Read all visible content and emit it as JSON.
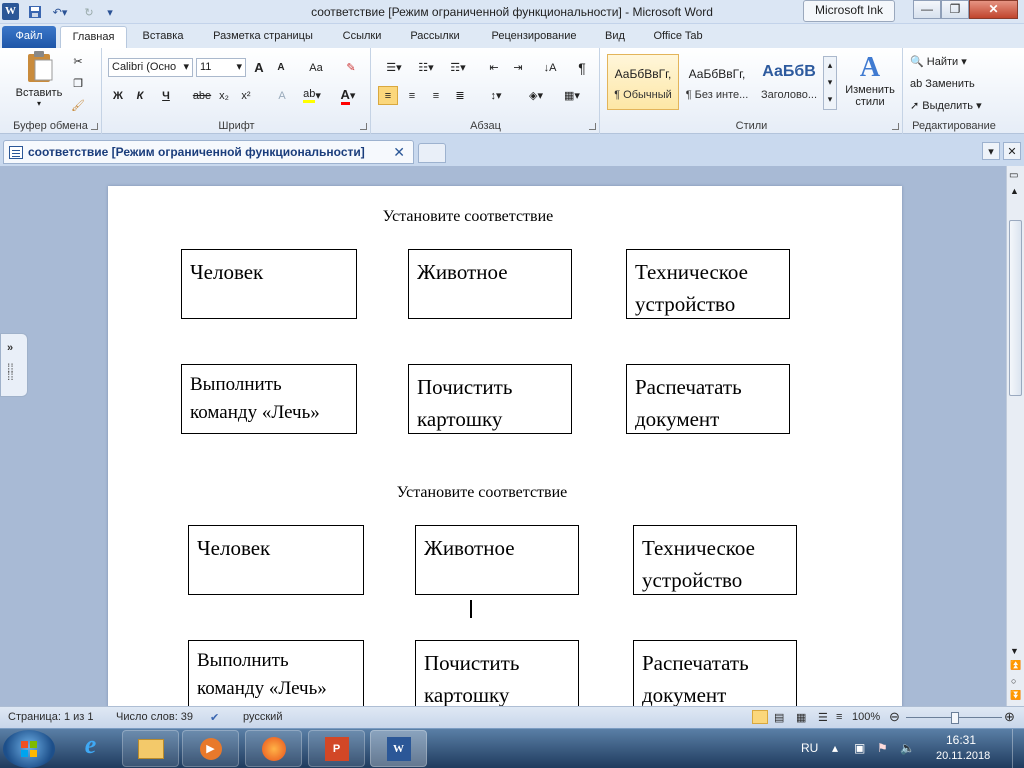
{
  "window": {
    "title": "соответствие [Режим ограниченной функциональности]  -  Microsoft Word",
    "ink_button": "Microsoft Ink"
  },
  "ribbon_tabs": [
    "Файл",
    "Главная",
    "Вставка",
    "Разметка страницы",
    "Ссылки",
    "Рассылки",
    "Рецензирование",
    "Вид",
    "Office Tab"
  ],
  "clipboard": {
    "paste_label": "Вставить",
    "group_label": "Буфер обмена"
  },
  "font": {
    "family": "Calibri (Осно",
    "size": "11",
    "group_label": "Шрифт",
    "bold": "Ж",
    "italic": "К",
    "underline": "Ч",
    "strike": "abe",
    "sub": "x₂",
    "sup": "x²",
    "grow": "A",
    "shrink": "A",
    "case": "Aa"
  },
  "paragraph": {
    "group_label": "Абзац",
    "pilcrow": "¶"
  },
  "styles": {
    "group_label": "Стили",
    "items": [
      {
        "sample": "АаБбВвГг,",
        "name": "¶ Обычный"
      },
      {
        "sample": "АаБбВвГг,",
        "name": "¶ Без инте..."
      },
      {
        "sample": "АаБбВ",
        "name": "Заголово..."
      }
    ],
    "change_label": "Изменить стили"
  },
  "editing": {
    "group_label": "Редактирование",
    "find": "Найти",
    "replace": "Заменить",
    "select": "Выделить"
  },
  "doc_tab": {
    "label": "соответствие [Режим ограниченной функциональности]"
  },
  "document": {
    "blocks": [
      {
        "title": "Установите соответствие",
        "row1": [
          "Человек",
          "Животное",
          "Техническое устройство"
        ],
        "row2": [
          "Выполнить команду «Лечь»",
          "Почистить картошку",
          "Распечатать документ"
        ]
      },
      {
        "title": "Установите соответствие",
        "row1": [
          "Человек",
          "Животное",
          "Техническое устройство"
        ],
        "row2": [
          "Выполнить команду «Лечь»",
          "Почистить картошку",
          "Распечатать документ"
        ]
      }
    ]
  },
  "status": {
    "page": "Страница: 1 из 1",
    "words": "Число слов: 39",
    "language": "русский",
    "zoom": "100%"
  },
  "taskbar": {
    "lang": "RU",
    "time": "16:31",
    "date": "20.11.2018"
  },
  "colors": {
    "accent": "#2b5797",
    "file_tab": "#1e56a8",
    "highlight": "#ffff00",
    "font_color": "#ff0000"
  }
}
